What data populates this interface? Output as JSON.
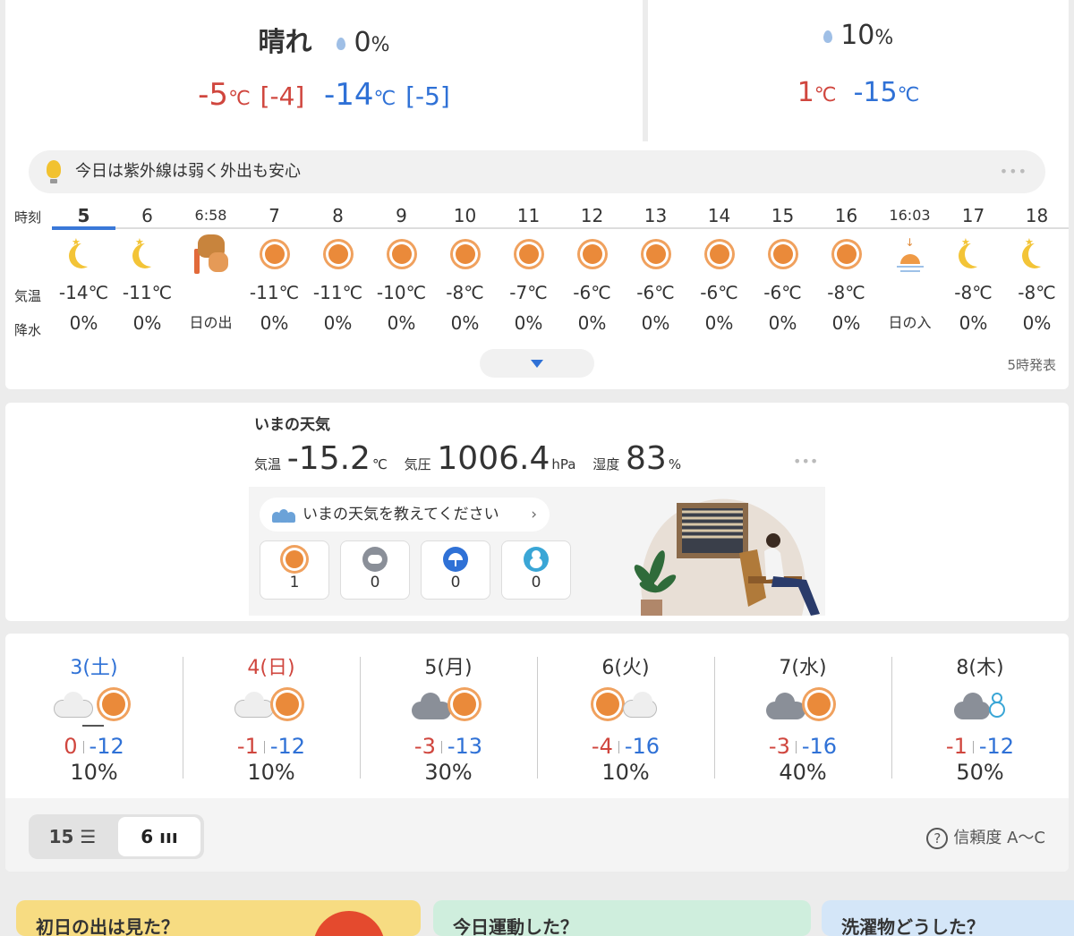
{
  "today": {
    "label": "晴れ",
    "precip": "0",
    "precip_unit": "%",
    "high": "-5",
    "high_unit": "℃",
    "high_diff": "[-4]",
    "low": "-14",
    "low_unit": "℃",
    "low_diff": "[-5]"
  },
  "tomorrow": {
    "precip": "10",
    "precip_unit": "%",
    "high": "1",
    "high_unit": "℃",
    "low": "-15",
    "low_unit": "℃"
  },
  "uv": {
    "text": "今日は紫外線は弱く外出も安心",
    "more": "•••"
  },
  "hourly": {
    "row_labels": {
      "time": "時刻",
      "temp": "気温",
      "precip": "降水"
    },
    "cols": [
      {
        "time": "5",
        "icon": "moon-icon",
        "temp": "-14℃",
        "precip": "0%"
      },
      {
        "time": "6",
        "icon": "moon-icon",
        "temp": "-11℃",
        "precip": "0%"
      },
      {
        "time": "6:58",
        "icon": "sunrise-icon",
        "temp": "",
        "precip": "日の出"
      },
      {
        "time": "7",
        "icon": "sun-icon",
        "temp": "-11℃",
        "precip": "0%"
      },
      {
        "time": "8",
        "icon": "sun-icon",
        "temp": "-11℃",
        "precip": "0%"
      },
      {
        "time": "9",
        "icon": "sun-icon",
        "temp": "-10℃",
        "precip": "0%"
      },
      {
        "time": "10",
        "icon": "sun-icon",
        "temp": "-8℃",
        "precip": "0%"
      },
      {
        "time": "11",
        "icon": "sun-icon",
        "temp": "-7℃",
        "precip": "0%"
      },
      {
        "time": "12",
        "icon": "sun-icon",
        "temp": "-6℃",
        "precip": "0%"
      },
      {
        "time": "13",
        "icon": "sun-icon",
        "temp": "-6℃",
        "precip": "0%"
      },
      {
        "time": "14",
        "icon": "sun-icon",
        "temp": "-6℃",
        "precip": "0%"
      },
      {
        "time": "15",
        "icon": "sun-icon",
        "temp": "-6℃",
        "precip": "0%"
      },
      {
        "time": "16",
        "icon": "sun-icon",
        "temp": "-8℃",
        "precip": "0%"
      },
      {
        "time": "16:03",
        "icon": "sunset-icon",
        "temp": "",
        "precip": "日の入"
      },
      {
        "time": "17",
        "icon": "moon-icon",
        "temp": "-8℃",
        "precip": "0%"
      },
      {
        "time": "18",
        "icon": "moon-icon",
        "temp": "-8℃",
        "precip": "0%"
      }
    ],
    "issued": "5時発表"
  },
  "now": {
    "title": "いまの天気",
    "temp_label": "気温",
    "temp": "-15.2",
    "temp_unit": "℃",
    "pressure_label": "気圧",
    "pressure": "1006.4",
    "pressure_unit": "hPa",
    "humidity_label": "湿度",
    "humidity": "83",
    "humidity_unit": "%",
    "more": "•••",
    "ask": "いまの天気を教えてください",
    "ask_chevron": "›",
    "votes": [
      {
        "icon": "sun-icon",
        "count": "1"
      },
      {
        "icon": "cloud-icon",
        "count": "0"
      },
      {
        "icon": "umbrella-icon",
        "count": "0"
      },
      {
        "icon": "snowman-icon",
        "count": "0"
      }
    ]
  },
  "weekly": {
    "days": [
      {
        "label": "3(土)",
        "high": "0",
        "low": "-12",
        "precip": "10%",
        "icon": "cloud-then-sun-icon"
      },
      {
        "label": "4(日)",
        "high": "-1",
        "low": "-12",
        "precip": "10%",
        "icon": "cloud-sun-icon"
      },
      {
        "label": "5(月)",
        "high": "-3",
        "low": "-13",
        "precip": "30%",
        "icon": "cloud-sun-icon"
      },
      {
        "label": "6(火)",
        "high": "-4",
        "low": "-16",
        "precip": "10%",
        "icon": "sun-then-cloud-icon"
      },
      {
        "label": "7(水)",
        "high": "-3",
        "low": "-16",
        "precip": "40%",
        "icon": "cloud-sun-icon"
      },
      {
        "label": "8(木)",
        "high": "-1",
        "low": "-12",
        "precip": "50%",
        "icon": "cloud-snow-icon"
      }
    ],
    "toggle_15": "15 ☰",
    "toggle_6": "6 ııı",
    "confidence_icon": "?",
    "confidence": "信頼度 A〜C"
  },
  "banners": [
    {
      "text": "初日の出は見た？"
    },
    {
      "text": "今日運動した？"
    },
    {
      "text": "洗濯物どうした？"
    }
  ],
  "colors": {
    "high": "#d0463e",
    "low": "#2f71d6",
    "sun": "#ea8a3a",
    "moon": "#f3c437",
    "selected": "#3a78d8"
  }
}
